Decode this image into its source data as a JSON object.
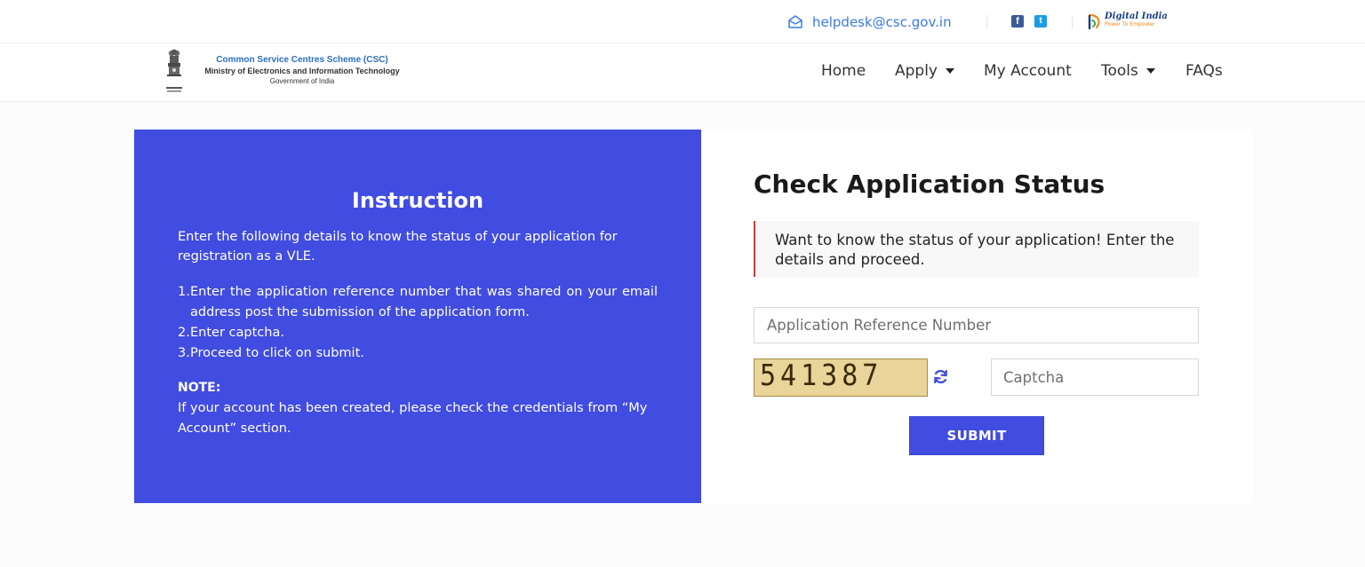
{
  "topbar": {
    "email": "helpdesk@csc.gov.in",
    "social": [
      {
        "icon": "facebook-icon",
        "glyph": "f",
        "color": "#3b5b99"
      },
      {
        "icon": "twitter-icon",
        "glyph": "t",
        "color": "#1d9be6"
      }
    ],
    "digital_india": {
      "title": "Digital India",
      "tagline": "Power To Empower"
    }
  },
  "header": {
    "org_name": "Common Service Centres Scheme (CSC)",
    "ministry": "Ministry of Electronics and Information Technology",
    "government": "Government of India",
    "nav": [
      {
        "label": "Home",
        "dropdown": false
      },
      {
        "label": "Apply",
        "dropdown": true
      },
      {
        "label": "My Account",
        "dropdown": false
      },
      {
        "label": "Tools",
        "dropdown": true
      },
      {
        "label": "FAQs",
        "dropdown": false
      }
    ]
  },
  "instruction": {
    "title": "Instruction",
    "intro": "Enter the following details to know the status of your application for registration as a VLE.",
    "steps": [
      {
        "num": "1.",
        "text": "Enter the application reference number that was shared on your email address post the submission of the application form."
      },
      {
        "num": "2.",
        "text": "Enter captcha."
      },
      {
        "num": "3.",
        "text": "Proceed to click on submit."
      }
    ],
    "note_label": "NOTE:",
    "note_text": "If your account has been created, please check the credentials from “My Account” section."
  },
  "form": {
    "title": "Check Application Status",
    "alert": "Want to know the status of your application! Enter the details and proceed.",
    "ref_placeholder": "Application Reference Number",
    "captcha_value": "541387",
    "captcha_placeholder": "Captcha",
    "submit_label": "SUBMIT"
  },
  "colors": {
    "primary": "#414ce0",
    "link": "#3a7be0",
    "alert_border": "#d43c3c",
    "captcha_bg": "#e9d49a"
  }
}
